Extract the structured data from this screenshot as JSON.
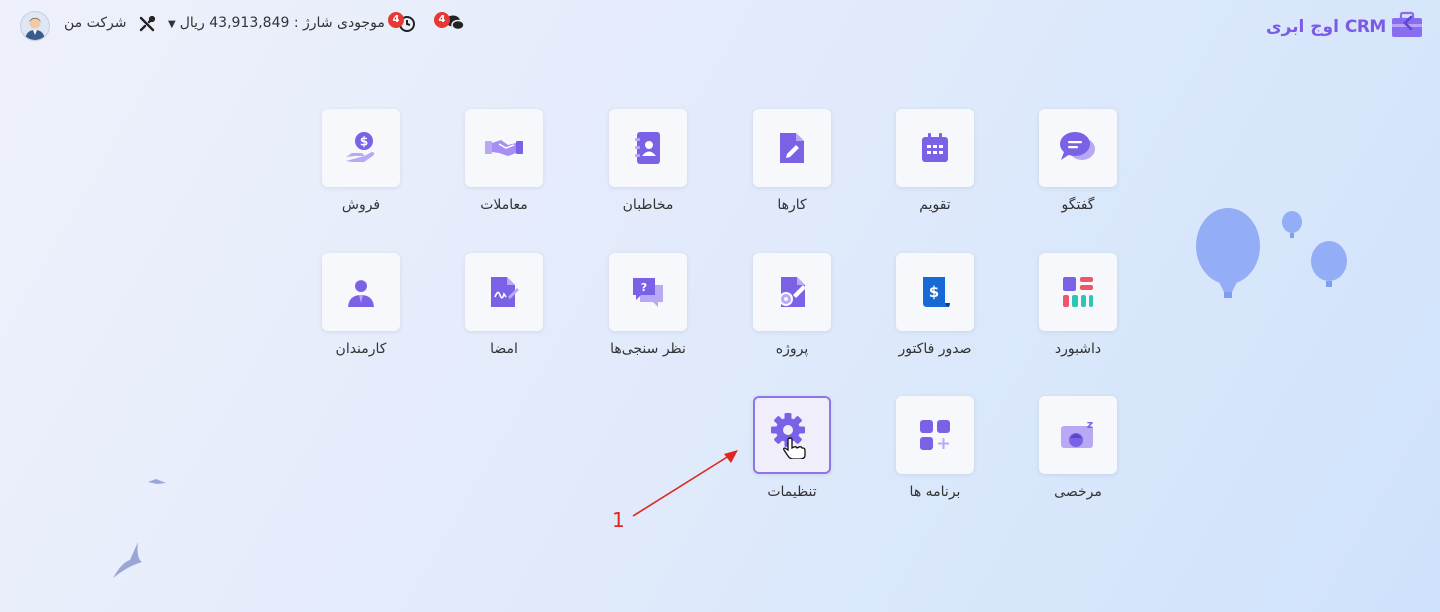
{
  "header": {
    "company": "شرکت من",
    "credit": "موجودی شارژ : 43,913,849 ریال",
    "history_badge": "4",
    "chat_badge": "4",
    "logo_text": "اوج ابری CRM"
  },
  "apps": [
    {
      "label": "گفتگو",
      "icon": "chat-icon"
    },
    {
      "label": "تقویم",
      "icon": "calendar-icon"
    },
    {
      "label": "کارها",
      "icon": "task-icon"
    },
    {
      "label": "مخاطبان",
      "icon": "contacts-book-icon"
    },
    {
      "label": "معاملات",
      "icon": "handshake-icon"
    },
    {
      "label": "فروش",
      "icon": "sales-money-icon"
    },
    {
      "label": "داشبورد",
      "icon": "dashboard-icon"
    },
    {
      "label": "صدور فاکتور",
      "icon": "invoice-icon"
    },
    {
      "label": "پروژه",
      "icon": "project-icon"
    },
    {
      "label": "نظر سنجی‌ها",
      "icon": "survey-icon"
    },
    {
      "label": "امضا",
      "icon": "signature-icon"
    },
    {
      "label": "کارمندان",
      "icon": "employee-icon"
    },
    {
      "label": "مرخصی",
      "icon": "leave-icon"
    },
    {
      "label": "برنامه ها",
      "icon": "apps-grid-icon"
    },
    {
      "label": "تنظیمات",
      "icon": "settings-gear-icon"
    }
  ],
  "annotation": {
    "number": "1"
  },
  "colors": {
    "accent": "#7b61e6",
    "badge": "#e53935",
    "annotation": "#e0261f"
  }
}
